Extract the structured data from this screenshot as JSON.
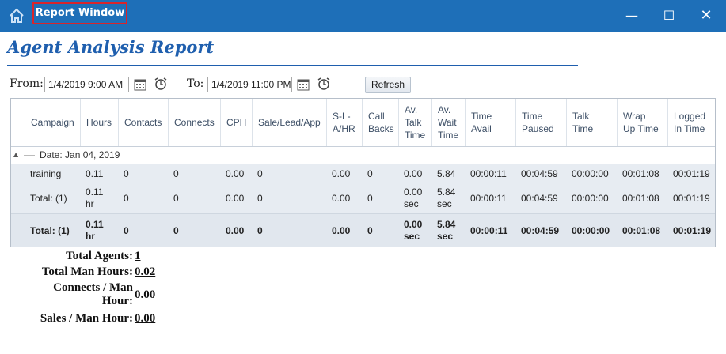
{
  "window": {
    "title": "Report Window",
    "icons": {
      "home": "home-icon",
      "minimize": "minimize-icon",
      "maximize": "maximize-icon",
      "close": "close-icon"
    },
    "colors": {
      "titlebar": "#1e6fb8",
      "highlight": "#d9242b"
    }
  },
  "window_glyphs": {
    "minimize": "—",
    "maximize": "☐",
    "close": "✕"
  },
  "report": {
    "title": "Agent Analysis Report",
    "from_label": "From:",
    "from_value": "1/4/2019 9:00 AM",
    "to_label": "To:",
    "to_value": "1/4/2019 11:00 PM",
    "refresh_label": "Refresh"
  },
  "grid": {
    "columns": [
      "Campaign",
      "Hours",
      "Contacts",
      "Connects",
      "CPH",
      "Sale/Lead/App",
      "S-L-A/HR",
      "Call Backs",
      "Av. Talk Time",
      "Av. Wait Time",
      "Time Avail",
      "Time Paused",
      "Talk Time",
      "Wrap Up Time",
      "Logged In Time"
    ],
    "group_label": "Date: Jan 04, 2019",
    "rows": [
      [
        "training",
        "0.11",
        "0",
        "0",
        "0.00",
        "0",
        "0.00",
        "0",
        "0.00",
        "5.84",
        "00:00:11",
        "00:04:59",
        "00:00:00",
        "00:01:08",
        "00:01:19"
      ],
      [
        "Total: (1)",
        "0.11 hr",
        "0",
        "0",
        "0.00",
        "0",
        "0.00",
        "0",
        "0.00 sec",
        "5.84 sec",
        "00:00:11",
        "00:04:59",
        "00:00:00",
        "00:01:08",
        "00:01:19"
      ],
      [
        "Total: (1)",
        "0.11 hr",
        "0",
        "0",
        "0.00",
        "0",
        "0.00",
        "0",
        "0.00 sec",
        "5.84 sec",
        "00:00:11",
        "00:04:59",
        "00:00:00",
        "00:01:08",
        "00:01:19"
      ]
    ]
  },
  "summary": {
    "total_agents_label": "Total Agents:",
    "total_agents_value": "1",
    "total_man_hours_label": "Total Man Hours:",
    "total_man_hours_value": "0.02",
    "connects_per_man_hour_label": "Connects / Man Hour:",
    "connects_per_man_hour_value": "0.00",
    "sales_per_man_hour_label": "Sales / Man Hour:",
    "sales_per_man_hour_value": "0.00"
  }
}
